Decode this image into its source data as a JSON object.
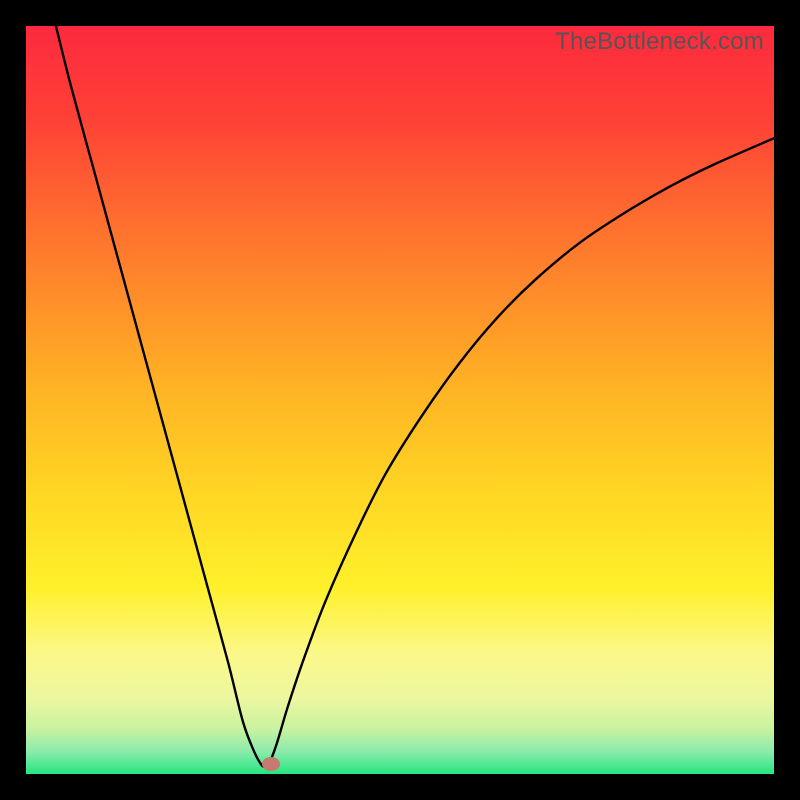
{
  "watermark": "TheBottleneck.com",
  "chart_data": {
    "type": "line",
    "title": "",
    "xlabel": "",
    "ylabel": "",
    "xlim": [
      0,
      100
    ],
    "ylim": [
      0,
      100
    ],
    "grid": false,
    "legend": false,
    "series": [
      {
        "name": "curve",
        "x": [
          4,
          6,
          9,
          12,
          15,
          18,
          21,
          24,
          27,
          29,
          30.5,
          31.5,
          32,
          32.5,
          33.5,
          35,
          37,
          40,
          44,
          48,
          53,
          58,
          63,
          68,
          74,
          80,
          86,
          92,
          100
        ],
        "y": [
          100,
          92,
          81,
          70,
          59,
          48,
          37,
          26,
          15,
          7,
          3,
          1.2,
          1,
          1.4,
          4,
          9,
          15,
          23,
          32,
          40,
          48,
          55,
          61,
          66,
          71,
          75,
          78.5,
          81.5,
          85
        ]
      }
    ],
    "marker": {
      "x": 32.7,
      "y": 1.3,
      "color": "#c77a6f"
    },
    "background_gradient": {
      "top": "#fd2a3e",
      "mid_upper": "#ff8b31",
      "mid": "#ffd524",
      "mid_lower": "#fcf66e",
      "near_bottom": "#e8f78c",
      "bottom": "#25e580"
    }
  }
}
